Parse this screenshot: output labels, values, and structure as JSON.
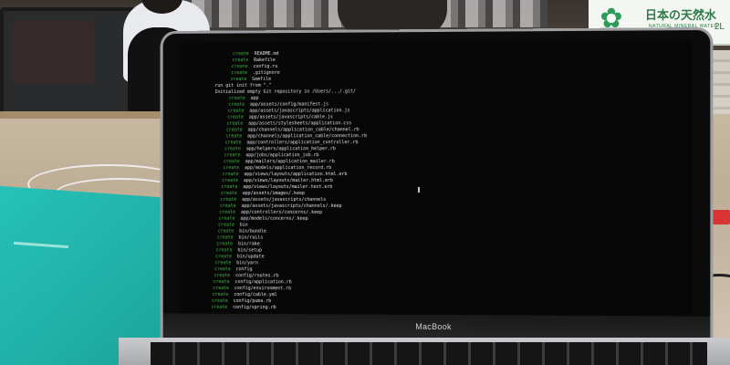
{
  "background": {
    "sign_title": "日本の天然水",
    "sign_subtitle": "NATURAL MINERAL WATER",
    "sign_corner": "2L"
  },
  "laptop": {
    "brand_label": "MacBook",
    "terminal_lines": [
      {
        "kw": "create",
        "text": "README.md"
      },
      {
        "kw": "create",
        "text": "Rakefile"
      },
      {
        "kw": "create",
        "text": "config.ru"
      },
      {
        "kw": "create",
        "text": ".gitignore"
      },
      {
        "kw": "create",
        "text": "Gemfile"
      },
      {
        "kw": "",
        "text": "  run  git init from \".\""
      },
      {
        "kw": "",
        "text": "Initialized empty Git repository in /Users/.../.git/"
      },
      {
        "kw": "create",
        "text": "app"
      },
      {
        "kw": "create",
        "text": "app/assets/config/manifest.js"
      },
      {
        "kw": "create",
        "text": "app/assets/javascripts/application.js"
      },
      {
        "kw": "create",
        "text": "app/assets/javascripts/cable.js"
      },
      {
        "kw": "create",
        "text": "app/assets/stylesheets/application.css"
      },
      {
        "kw": "create",
        "text": "app/channels/application_cable/channel.rb"
      },
      {
        "kw": "create",
        "text": "app/channels/application_cable/connection.rb"
      },
      {
        "kw": "create",
        "text": "app/controllers/application_controller.rb"
      },
      {
        "kw": "create",
        "text": "app/helpers/application_helper.rb"
      },
      {
        "kw": "create",
        "text": "app/jobs/application_job.rb"
      },
      {
        "kw": "create",
        "text": "app/mailers/application_mailer.rb"
      },
      {
        "kw": "create",
        "text": "app/models/application_record.rb"
      },
      {
        "kw": "create",
        "text": "app/views/layouts/application.html.erb"
      },
      {
        "kw": "create",
        "text": "app/views/layouts/mailer.html.erb"
      },
      {
        "kw": "create",
        "text": "app/views/layouts/mailer.text.erb"
      },
      {
        "kw": "create",
        "text": "app/assets/images/.keep"
      },
      {
        "kw": "create",
        "text": "app/assets/javascripts/channels"
      },
      {
        "kw": "create",
        "text": "app/assets/javascripts/channels/.keep"
      },
      {
        "kw": "create",
        "text": "app/controllers/concerns/.keep"
      },
      {
        "kw": "create",
        "text": "app/models/concerns/.keep"
      },
      {
        "kw": "create",
        "text": "bin"
      },
      {
        "kw": "create",
        "text": "bin/bundle"
      },
      {
        "kw": "create",
        "text": "bin/rails"
      },
      {
        "kw": "create",
        "text": "bin/rake"
      },
      {
        "kw": "create",
        "text": "bin/setup"
      },
      {
        "kw": "create",
        "text": "bin/update"
      },
      {
        "kw": "create",
        "text": "bin/yarn"
      },
      {
        "kw": "create",
        "text": "config"
      },
      {
        "kw": "create",
        "text": "config/routes.rb"
      },
      {
        "kw": "create",
        "text": "config/application.rb"
      },
      {
        "kw": "create",
        "text": "config/environment.rb"
      },
      {
        "kw": "create",
        "text": "config/cable.yml"
      },
      {
        "kw": "create",
        "text": "config/puma.rb"
      },
      {
        "kw": "create",
        "text": "config/spring.rb"
      }
    ]
  }
}
